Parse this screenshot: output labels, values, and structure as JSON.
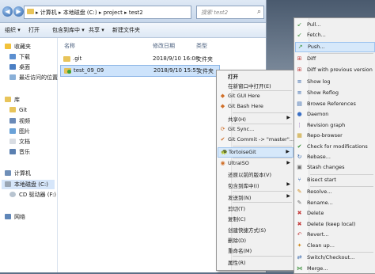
{
  "address": {
    "crumbs": "▸ 计算机 ▸ 本地磁盘 (C:) ▸ project ▸ test2",
    "search_placeholder": "搜索 test2"
  },
  "toolbar": {
    "organize": "组织 ▾",
    "open": "打开",
    "include_in_library": "包含到库中 ▾",
    "share": "共享 ▾",
    "new_folder": "新建文件夹"
  },
  "sidebar": {
    "favorites": "收藏夹",
    "downloads": "下载",
    "desktop": "桌面",
    "recent": "最近访问的位置",
    "libraries": "库",
    "git": "Git",
    "videos": "视频",
    "pictures": "图片",
    "documents": "文档",
    "music": "音乐",
    "computer": "计算机",
    "local_disk": "本地磁盘 (C:)",
    "cd_drive": "CD 驱动器 (F:)",
    "network": "网络"
  },
  "columns": {
    "name": "名称",
    "modified": "修改日期",
    "type": "类型"
  },
  "files": [
    {
      "name": ".git",
      "modified": "2018/9/10 16:08",
      "type": "文件夹"
    },
    {
      "name": "test_09_09",
      "modified": "2018/9/10 15:55",
      "type": "文件夹"
    }
  ],
  "context_menu": [
    {
      "label": "打开",
      "bold": true
    },
    {
      "label": "在新窗口中打开(E)"
    },
    {
      "label": "Git GUI Here",
      "icon": "◆"
    },
    {
      "label": "Git Bash Here",
      "icon": "◆"
    },
    {
      "label": "共享(H)",
      "submenu": true
    },
    {
      "label": "Git Sync...",
      "icon": "⟳"
    },
    {
      "label": "Git Commit -> \"master\"...",
      "icon": "✔"
    },
    {
      "label": "TortoiseGit",
      "icon": "🐢",
      "submenu": true
    },
    {
      "label": "UltraISO",
      "icon": "◉",
      "submenu": true
    },
    {
      "label": "还原以前的版本(V)"
    },
    {
      "label": "包含到库中(I)",
      "submenu": true
    },
    {
      "label": "发送到(N)",
      "submenu": true
    },
    {
      "label": "剪切(T)"
    },
    {
      "label": "复制(C)"
    },
    {
      "label": "创建快捷方式(S)"
    },
    {
      "label": "删除(D)"
    },
    {
      "label": "重命名(M)"
    },
    {
      "label": "属性(R)"
    }
  ],
  "tortoisegit_menu": [
    {
      "label": "Pull...",
      "icon": "↙",
      "color": "#2f8a2f"
    },
    {
      "label": "Fetch...",
      "icon": "↙",
      "color": "#2f8a2f"
    },
    {
      "label": "Push...",
      "icon": "↗",
      "color": "#2f8a2f"
    },
    {
      "label": "Diff",
      "icon": "⊞",
      "color": "#c43c3c"
    },
    {
      "label": "Diff with previous version",
      "icon": "⊞",
      "color": "#c43c3c"
    },
    {
      "label": "Show log",
      "icon": "≡",
      "color": "#2c5fa8"
    },
    {
      "label": "Show Reflog",
      "icon": "≡",
      "color": "#2c5fa8"
    },
    {
      "label": "Browse References",
      "icon": "▤",
      "color": "#2c5fa8"
    },
    {
      "label": "Daemon",
      "icon": "●",
      "color": "#3a6fc4"
    },
    {
      "label": "Revision graph",
      "icon": "⋮",
      "color": "#7a4ab0"
    },
    {
      "label": "Repo-browser",
      "icon": "▦",
      "color": "#c9a12a"
    },
    {
      "label": "Check for modifications",
      "icon": "✔",
      "color": "#2f8a2f"
    },
    {
      "label": "Rebase...",
      "icon": "↻",
      "color": "#2c5fa8"
    },
    {
      "label": "Stash changes",
      "icon": "▣",
      "color": "#6a6a6a"
    },
    {
      "label": "Bisect start",
      "icon": "⑂",
      "color": "#2c5fa8"
    },
    {
      "label": "Resolve...",
      "icon": "✎",
      "color": "#d08a1c"
    },
    {
      "label": "Rename...",
      "icon": "✎",
      "color": "#6a6a6a"
    },
    {
      "label": "Delete",
      "icon": "✖",
      "color": "#c43c3c"
    },
    {
      "label": "Delete (keep local)",
      "icon": "✖",
      "color": "#c43c3c"
    },
    {
      "label": "Revert...",
      "icon": "↶",
      "color": "#c43c3c"
    },
    {
      "label": "Clean up...",
      "icon": "✦",
      "color": "#d08a1c"
    },
    {
      "label": "Switch/Checkout...",
      "icon": "⇄",
      "color": "#2c5fa8"
    },
    {
      "label": "Merge...",
      "icon": "⋈",
      "color": "#2f8a2f"
    }
  ]
}
